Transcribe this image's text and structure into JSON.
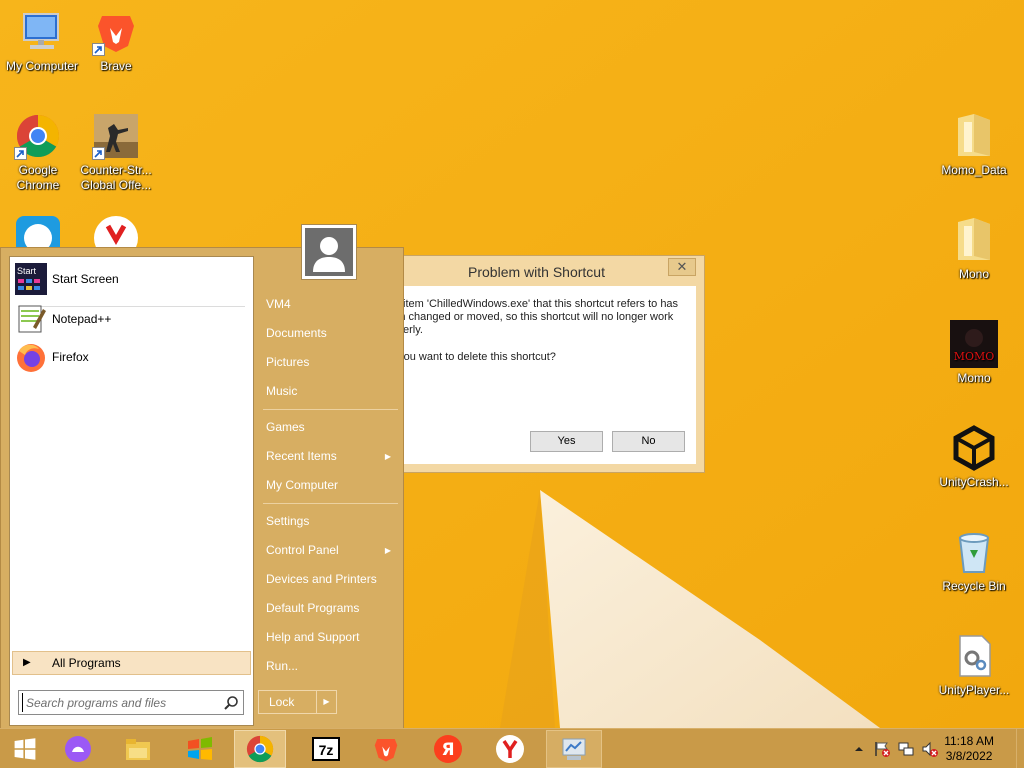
{
  "desktop": {
    "left_icons": [
      {
        "label": "My Computer"
      },
      {
        "label": "Brave"
      },
      {
        "label": "Google Chrome"
      },
      {
        "label": "Counter-Str... Global Offe..."
      }
    ],
    "right_icons": [
      {
        "label": "Momo_Data"
      },
      {
        "label": "Mono"
      },
      {
        "label": "Momo",
        "logo_text": "MOMO"
      },
      {
        "label": "UnityCrash..."
      },
      {
        "label": "Recycle Bin"
      },
      {
        "label": "UnityPlayer..."
      }
    ]
  },
  "dialog": {
    "title": "Problem with Shortcut",
    "close_label": "✕",
    "message": "The item 'ChilledWindows.exe' that this shortcut refers to has been changed or moved, so this shortcut will no longer work properly.",
    "question": "Do you want to delete this shortcut?",
    "yes_label": "Yes",
    "no_label": "No"
  },
  "start_menu": {
    "pinned": [
      {
        "label": "Start Screen",
        "icon": "start-screen-icon",
        "icon_text": "Start"
      },
      {
        "label": "Notepad++",
        "icon": "notepad-plus-plus-icon"
      },
      {
        "label": "Firefox",
        "icon": "firefox-icon"
      }
    ],
    "all_programs_label": "All Programs",
    "search_placeholder": "Search programs and files",
    "right_items": [
      {
        "label": "VM4"
      },
      {
        "label": "Documents"
      },
      {
        "label": "Pictures"
      },
      {
        "label": "Music"
      },
      {
        "label": "Games"
      },
      {
        "label": "Recent Items",
        "submenu": true
      },
      {
        "label": "My Computer"
      },
      {
        "label": "Settings"
      },
      {
        "label": "Control Panel",
        "submenu": true
      },
      {
        "label": "Devices and Printers"
      },
      {
        "label": "Default Programs"
      },
      {
        "label": "Help and Support"
      },
      {
        "label": "Run..."
      }
    ],
    "lock_label": "Lock"
  },
  "taskbar": {
    "apps": [
      "start-button",
      "cortana-icon",
      "file-explorer-icon",
      "windows-flag-icon",
      "chrome-icon",
      "7zip-icon",
      "brave-icon",
      "yandex-icon",
      "yandex-browser-icon",
      "control-panel-icon"
    ],
    "sevenzip_text": "7z",
    "yandex_text": "Я",
    "clock_time": "11:18 AM",
    "clock_date": "3/8/2022"
  },
  "colors": {
    "wallpaper": "#f5b31a",
    "start_menu_bg": "#d7ae62",
    "taskbar_bg": "#c99a48"
  }
}
